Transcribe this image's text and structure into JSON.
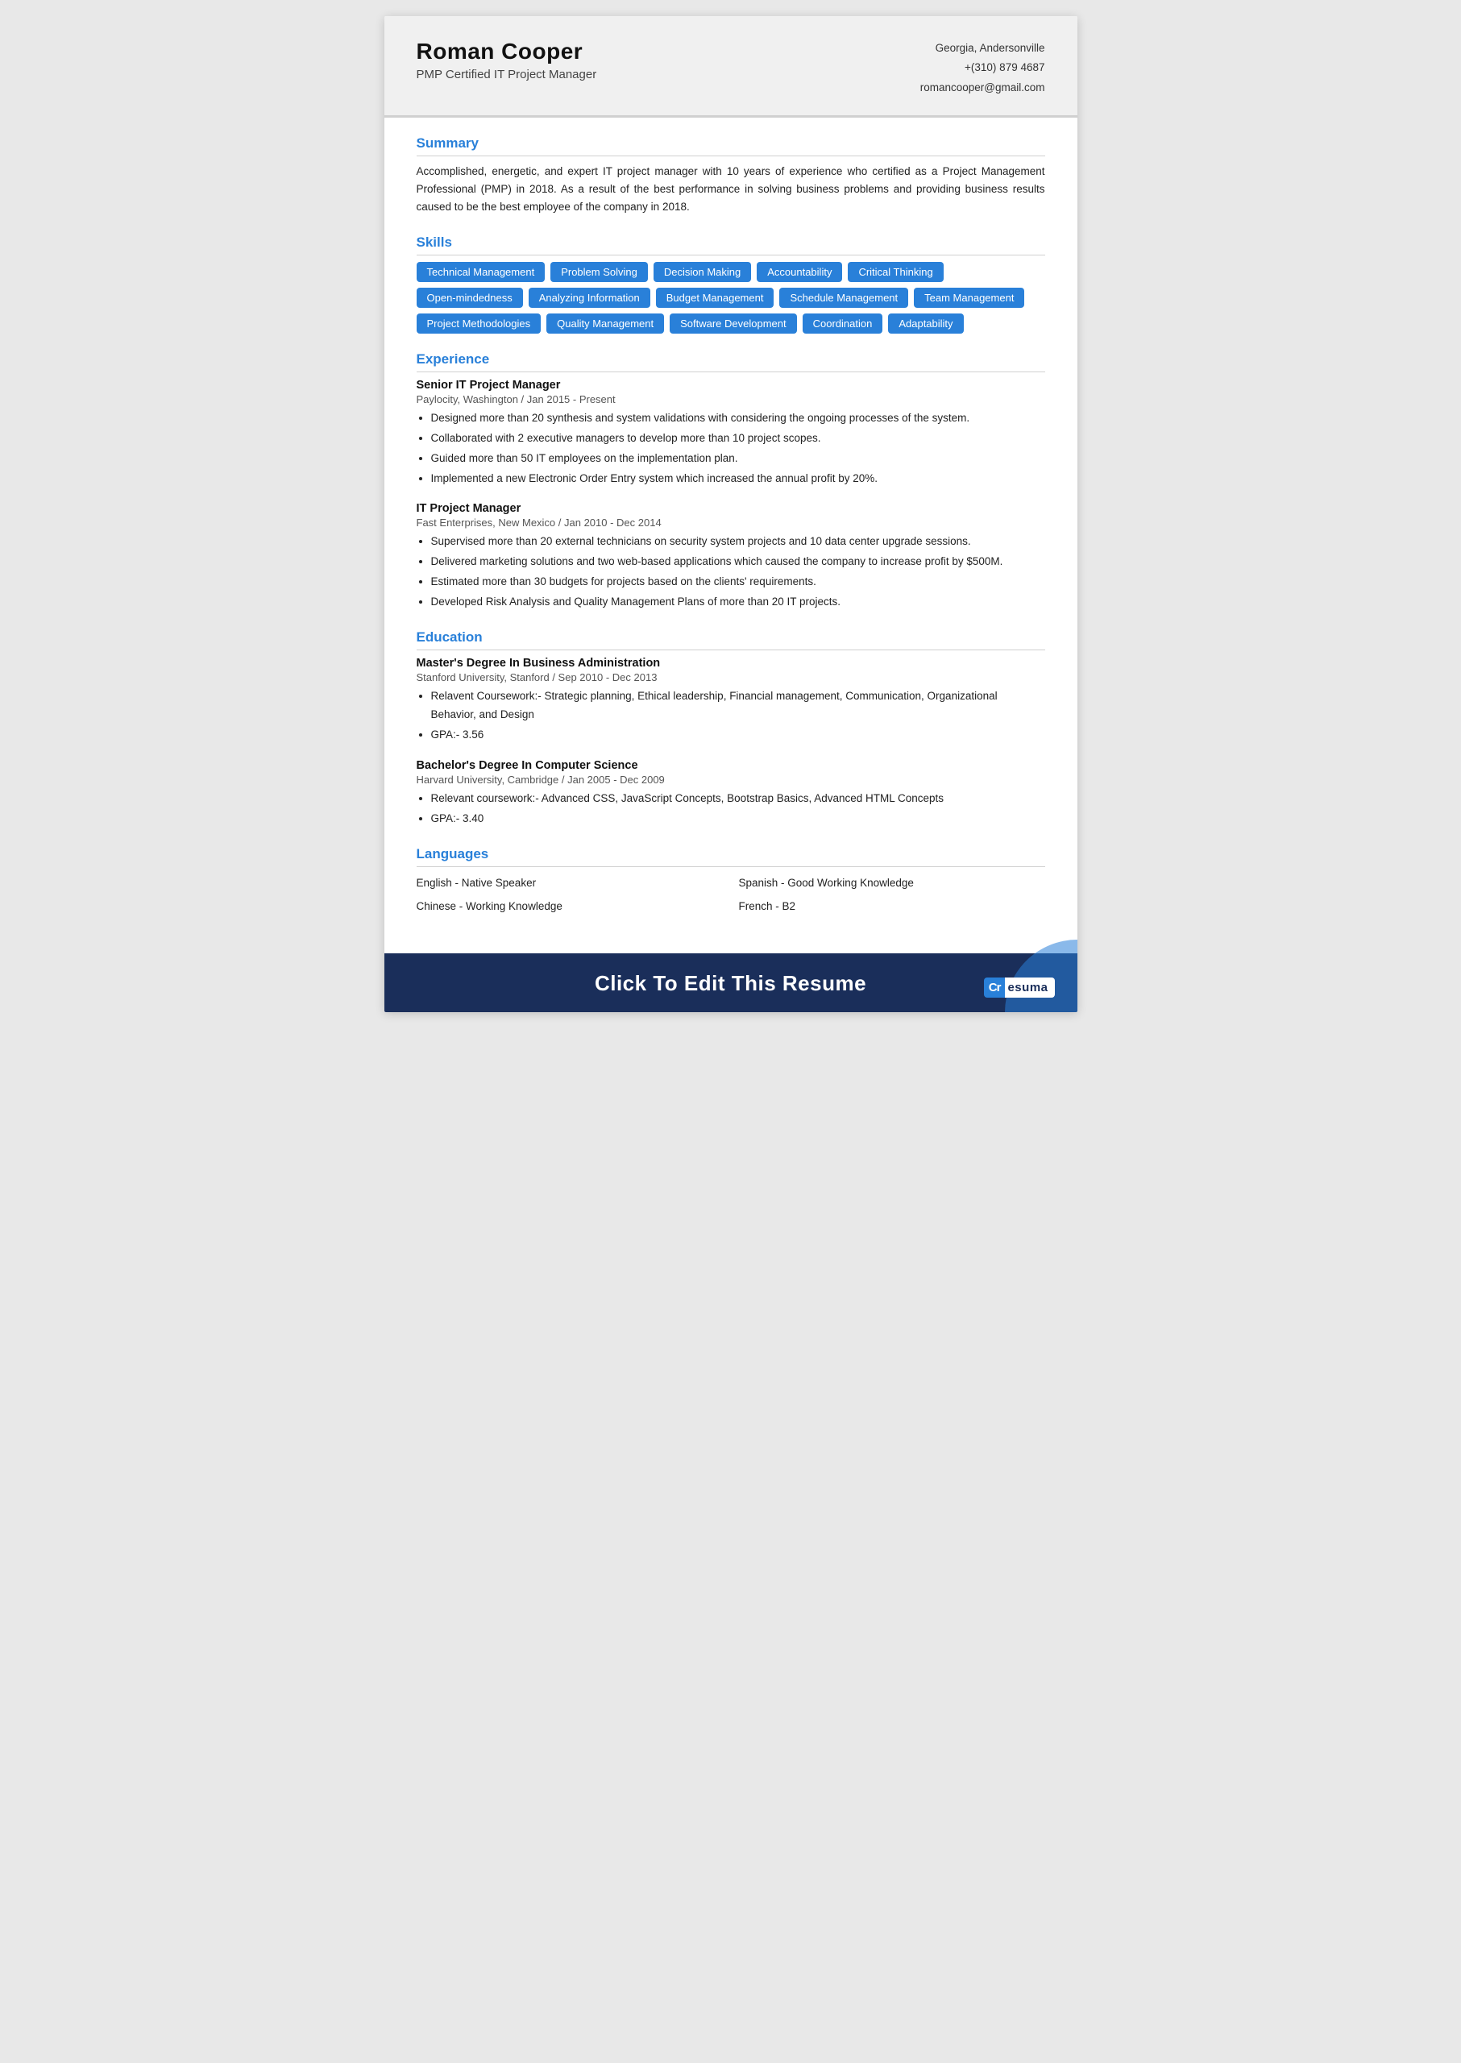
{
  "header": {
    "name": "Roman Cooper",
    "title": "PMP Certified IT Project Manager",
    "location": "Georgia, Andersonville",
    "phone": "+(310) 879 4687",
    "email": "romancooper@gmail.com"
  },
  "summary": {
    "section_title": "Summary",
    "text": "Accomplished, energetic, and expert IT project manager with 10 years of experience who certified as a Project Management Professional (PMP) in 2018. As a result of the best performance in solving business problems and providing business results caused to be the best employee of the company in 2018."
  },
  "skills": {
    "section_title": "Skills",
    "items": [
      "Technical Management",
      "Problem Solving",
      "Decision Making",
      "Accountability",
      "Critical Thinking",
      "Open-mindedness",
      "Analyzing Information",
      "Budget Management",
      "Schedule Management",
      "Team Management",
      "Project Methodologies",
      "Quality Management",
      "Software Development",
      "Coordination",
      "Adaptability"
    ]
  },
  "experience": {
    "section_title": "Experience",
    "jobs": [
      {
        "title": "Senior IT Project Manager",
        "meta": "Paylocity, Washington / Jan 2015 - Present",
        "bullets": [
          "Designed more than 20 synthesis and system validations with considering the ongoing processes of the system.",
          "Collaborated with 2 executive managers to develop more than 10 project scopes.",
          "Guided more than 50 IT employees on the implementation plan.",
          "Implemented a new Electronic Order Entry system which increased the annual profit by 20%."
        ]
      },
      {
        "title": "IT Project Manager",
        "meta": "Fast Enterprises, New Mexico / Jan 2010 - Dec 2014",
        "bullets": [
          "Supervised more than 20 external technicians on security system projects and 10 data center upgrade sessions.",
          "Delivered marketing solutions and two web-based applications which caused the company to increase profit by $500M.",
          "Estimated more than 30 budgets for projects based on the clients' requirements.",
          "Developed Risk Analysis and Quality Management Plans of more than 20 IT projects."
        ]
      }
    ]
  },
  "education": {
    "section_title": "Education",
    "degrees": [
      {
        "title": "Master's Degree In Business Administration",
        "meta": "Stanford University, Stanford / Sep 2010 - Dec 2013",
        "bullets": [
          "Relavent Coursework:- Strategic planning, Ethical leadership, Financial management, Communication, Organizational Behavior, and Design",
          "GPA:- 3.56"
        ]
      },
      {
        "title": "Bachelor's Degree In Computer Science",
        "meta": "Harvard University, Cambridge / Jan 2005 - Dec 2009",
        "bullets": [
          "Relevant coursework:- Advanced CSS, JavaScript Concepts,  Bootstrap Basics, Advanced HTML Concepts",
          "GPA:- 3.40"
        ]
      }
    ]
  },
  "languages": {
    "section_title": "Languages",
    "items": [
      {
        "lang": "English - Native Speaker",
        "col": 1
      },
      {
        "lang": "Spanish - Good Working Knowledge",
        "col": 2
      },
      {
        "lang": "Chinese - Working Knowledge",
        "col": 1
      },
      {
        "lang": "French - B2",
        "col": 2
      }
    ]
  },
  "footer": {
    "cta": "Click To Edit This Resume",
    "brand_icon": "C",
    "brand_r": "r",
    "brand_text": "esuma"
  }
}
